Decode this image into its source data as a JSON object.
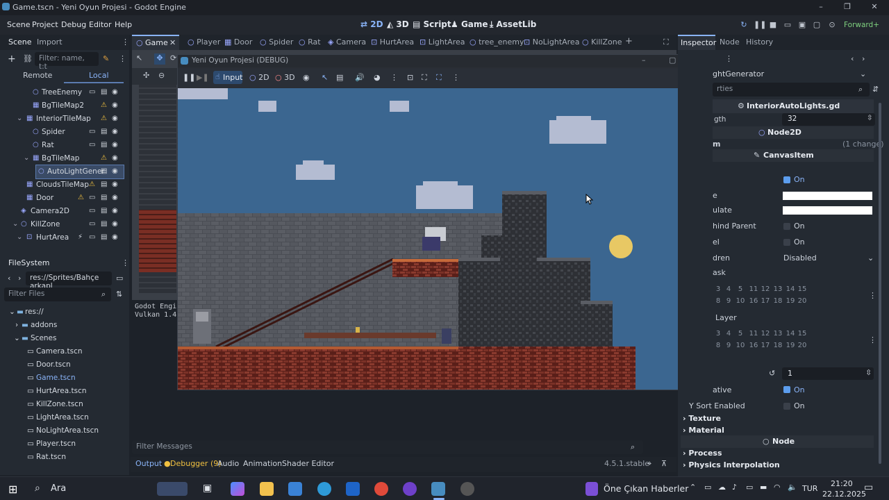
{
  "window": {
    "title": "Game.tscn - Yeni Oyun Projesi - Godot Engine"
  },
  "menu": {
    "items": [
      "Scene",
      "Project",
      "Debug",
      "Editor",
      "Help"
    ]
  },
  "modes": {
    "m2d": "2D",
    "m3d": "3D",
    "script": "Script",
    "game": "Game",
    "assetlib": "AssetLib"
  },
  "renderer": "Forward+",
  "scene_dock": {
    "tabs": [
      "Scene",
      "Import"
    ],
    "filter_placeholder": "Filter: name, t:t",
    "subtabs": [
      "Remote",
      "Local"
    ],
    "nodes": [
      {
        "label": "TreeEnemy"
      },
      {
        "label": "BgTileMap2"
      },
      {
        "label": "InteriorTileMap"
      },
      {
        "label": "Spider"
      },
      {
        "label": "Rat"
      },
      {
        "label": "BgTileMap"
      },
      {
        "label": "AutoLightGener"
      },
      {
        "label": "CloudsTileMap"
      },
      {
        "label": "Door"
      },
      {
        "label": "Camera2D"
      },
      {
        "label": "KillZone"
      },
      {
        "label": "HurtArea"
      }
    ]
  },
  "filesystem": {
    "title": "FileSystem",
    "path": "res://Sprites/Bahçe arkapl",
    "filter_placeholder": "Filter Files",
    "items": [
      "res://",
      "addons",
      "Scenes",
      "Camera.tscn",
      "Door.tscn",
      "Game.tscn",
      "HurtArea.tscn",
      "KillZone.tscn",
      "LightArea.tscn",
      "NoLightArea.tscn",
      "Player.tscn",
      "Rat.tscn"
    ]
  },
  "scene_tabs": [
    "Game",
    "Player",
    "Door",
    "Spider",
    "Rat",
    "Camera",
    "HurtArea",
    "LightArea",
    "tree_enemy",
    "NoLightArea",
    "KillZone"
  ],
  "game_window": {
    "title": "Yeni Oyun Projesi (DEBUG)",
    "toolbar": {
      "input": "Input",
      "m2d": "2D",
      "m3d": "3D"
    },
    "resolution": "1152x648"
  },
  "console": {
    "lines": [
      "Godot Engin",
      "Vulkan 1.4."
    ],
    "filter_placeholder": "Filter Messages"
  },
  "bottom_tabs": [
    "Output",
    "Debugger (9)",
    "Audio",
    "Animation",
    "Shader Editor"
  ],
  "version": "4.5.1.stable",
  "inspector": {
    "tabs": [
      "Inspector",
      "Node",
      "History"
    ],
    "node_type_partial": "ghtGenerator",
    "filter_partial": "rties",
    "script": "InteriorAutoLights.gd",
    "length_label": "gth",
    "length_value": "32",
    "sections": [
      "Node2D",
      "CanvasItem",
      "Node"
    ],
    "changes": "(1 change)",
    "item_label": "m",
    "visible_on": "On",
    "modulate_label": "e",
    "self_modulate_label": "ulate",
    "show_behind_label": "hind Parent",
    "show_behind_value": "On",
    "top_level_label": "el",
    "top_level_value": "On",
    "clip_children_label": "dren",
    "clip_children_value": "Disabled",
    "light_mask_label": "ask",
    "visibility_layer_label": "Layer",
    "ordering_value": "1",
    "z_relative_label": "ative",
    "z_relative_value": "On",
    "y_sort_label": "Y Sort Enabled",
    "y_sort_value": "On",
    "groups": [
      "Texture",
      "Material"
    ],
    "node_groups": [
      "Process",
      "Physics Interpolation"
    ],
    "mask_row1": [
      "3",
      "4",
      "5",
      "11",
      "12",
      "13",
      "14",
      "15"
    ],
    "mask_row2": [
      "8",
      "9",
      "10",
      "16",
      "17",
      "18",
      "19",
      "20"
    ]
  },
  "taskbar": {
    "search": "Ara",
    "news": "Öne Çıkan Haberler",
    "lang": "TUR",
    "time": "21:20",
    "date": "22.12.2025"
  },
  "colors": {
    "accent": "#8ab4f8",
    "sky": "#3b6690",
    "brick": "#8a3a2e"
  }
}
